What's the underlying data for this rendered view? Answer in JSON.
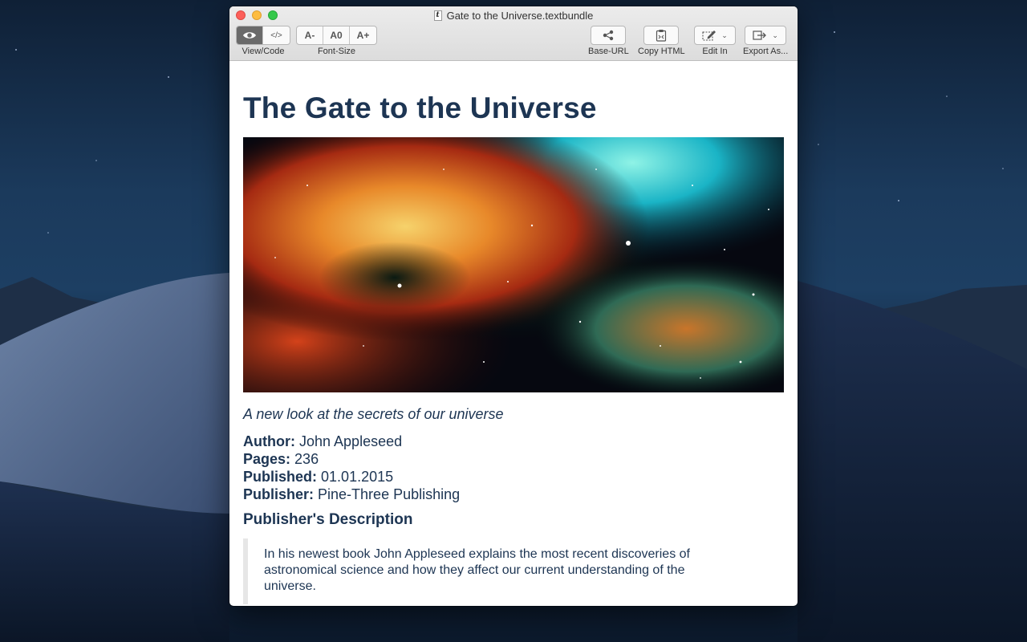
{
  "window": {
    "title": "Gate to the Universe.textbundle",
    "doc_icon_glyph": "t"
  },
  "toolbar": {
    "view_code_label": "View/Code",
    "font_size_label": "Font-Size",
    "base_url_label": "Base-URL",
    "copy_html_label": "Copy HTML",
    "edit_in_label": "Edit In",
    "export_as_label": "Export As...",
    "code_glyph": "</>",
    "font_decrease_glyph": "A-",
    "font_reset_glyph": "A0",
    "font_increase_glyph": "A+"
  },
  "document": {
    "title": "The Gate to the Universe",
    "subtitle": "A new look at the secrets of our universe",
    "meta": [
      {
        "key": "Author:",
        "value": "John Appleseed"
      },
      {
        "key": "Pages:",
        "value": "236"
      },
      {
        "key": "Published:",
        "value": "01.01.2015"
      },
      {
        "key": "Publisher:",
        "value": "Pine-Three Publishing"
      }
    ],
    "section_heading": "Publisher's Description",
    "quote": "In his newest book John Appleseed explains the most recent discoveries of astronomical science and how they affect our current understanding of the universe."
  },
  "colors": {
    "heading": "#1d3553",
    "active_segment": "#6a6a6a"
  }
}
